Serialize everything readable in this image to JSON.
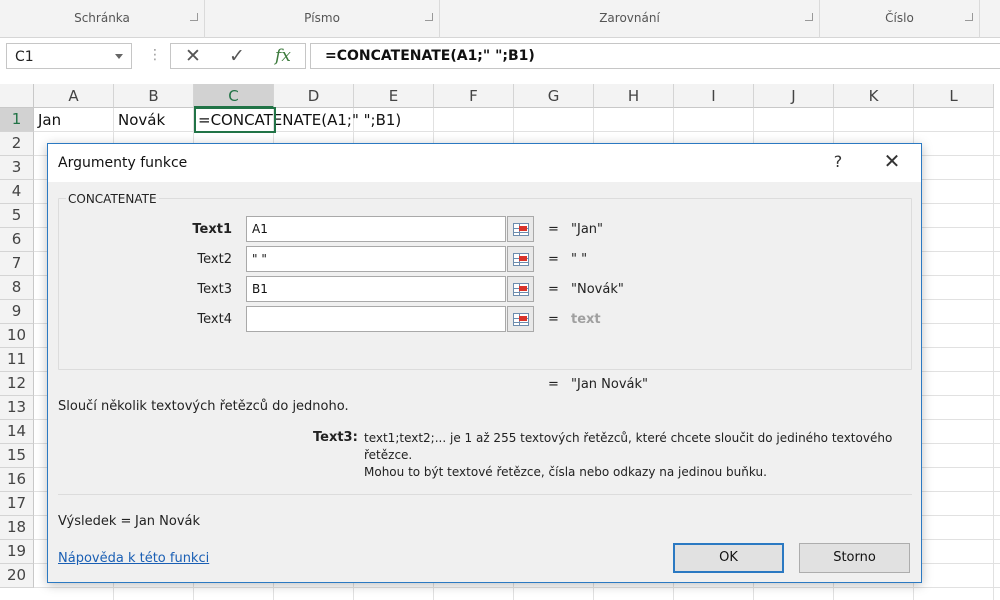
{
  "ribbon": {
    "groups": [
      "Schránka",
      "Písmo",
      "Zarovnání",
      "Číslo"
    ]
  },
  "formula_bar": {
    "name_box": "C1",
    "fx_label": "fx",
    "formula": "=CONCATENATE(A1;\" \";B1)"
  },
  "sheet": {
    "columns": [
      "A",
      "B",
      "C",
      "D",
      "E",
      "F",
      "G",
      "H",
      "I",
      "J",
      "K",
      "L"
    ],
    "rows": [
      "1",
      "2",
      "3",
      "4",
      "5",
      "6",
      "7",
      "8",
      "9",
      "10",
      "11",
      "12",
      "13",
      "14",
      "15",
      "16",
      "17",
      "18",
      "19",
      "20"
    ],
    "cells": {
      "A1": "Jan",
      "B1": "Novák",
      "C1": "=CONCATENATE(A1;\" \";B1)"
    },
    "selected_cell": "C1"
  },
  "dialog": {
    "title": "Argumenty funkce",
    "help_glyph": "?",
    "close_glyph": "✕",
    "function_name": "CONCATENATE",
    "arguments": [
      {
        "label": "Text1",
        "value": "A1",
        "result": "\"Jan\""
      },
      {
        "label": "Text2",
        "value": "\" \"",
        "result": "\" \""
      },
      {
        "label": "Text3",
        "value": "B1",
        "result": "\"Novák\""
      },
      {
        "label": "Text4",
        "value": "",
        "result": "text"
      }
    ],
    "equals": "=",
    "formula_result": "\"Jan Novák\"",
    "description": "Sloučí několik textových řetězců do jednoho.",
    "arg_name": "Text3:",
    "arg_description_line1": "text1;text2;... je 1 až 255 textových řetězců, které chcete sloučit do jediného textového řetězce.",
    "arg_description_line2": "Mohou to být textové řetězce, čísla nebo odkazy na jedinou buňku.",
    "result_label": "Výsledek =",
    "result_value": "Jan Novák",
    "help_link": "Nápověda k této funkci",
    "ok_label": "OK",
    "cancel_label": "Storno"
  }
}
